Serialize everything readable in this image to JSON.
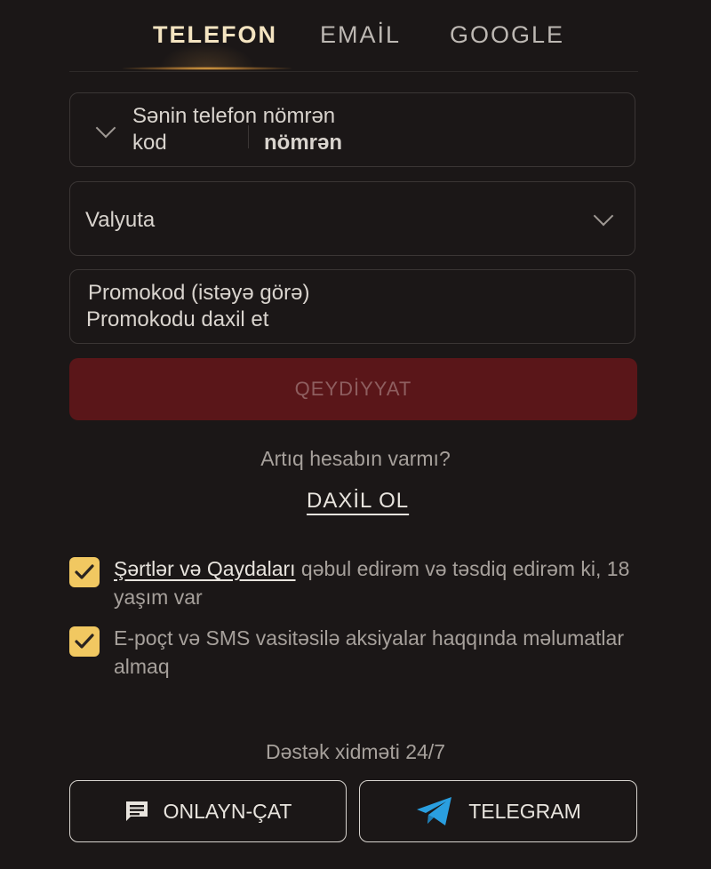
{
  "tabs": [
    {
      "label": "TELEFON",
      "active": true
    },
    {
      "label": "EMAİL",
      "active": false
    },
    {
      "label": "GOOGLE",
      "active": false
    }
  ],
  "phone": {
    "label": "Sənin telefon nömrən",
    "code_placeholder": "kod",
    "number_placeholder": "nömrən"
  },
  "currency": {
    "label": "Valyuta"
  },
  "promo": {
    "label": "Promokod (istəyə görə)",
    "placeholder": "Promokodu daxil et"
  },
  "submit_label": "QEYDİYYAT",
  "have_account": "Artıq hesabın varmı?",
  "login_label": "DAXİL OL",
  "terms": {
    "link": "Şərtlər və Qaydaları",
    "text": " qəbul edirəm və təsdiq edirəm ki, 18 yaşım var",
    "checked": true
  },
  "marketing": {
    "text": "E-poçt və SMS vasitəsilə aksiyalar haqqında məlumatlar almaq",
    "checked": true
  },
  "support": {
    "title": "Dəstək xidməti 24/7",
    "chat_label": "ONLAYN-ÇAT",
    "telegram_label": "TELEGRAM"
  },
  "colors": {
    "background": "#1b1717",
    "accent": "#f1c861",
    "submit_bg": "#5a1619",
    "telegram": "#2a9fe0"
  },
  "icons": {
    "chat": "chat-bubble-icon",
    "telegram": "telegram-plane-icon",
    "chevron": "chevron-down-icon",
    "check": "checkmark-icon"
  }
}
